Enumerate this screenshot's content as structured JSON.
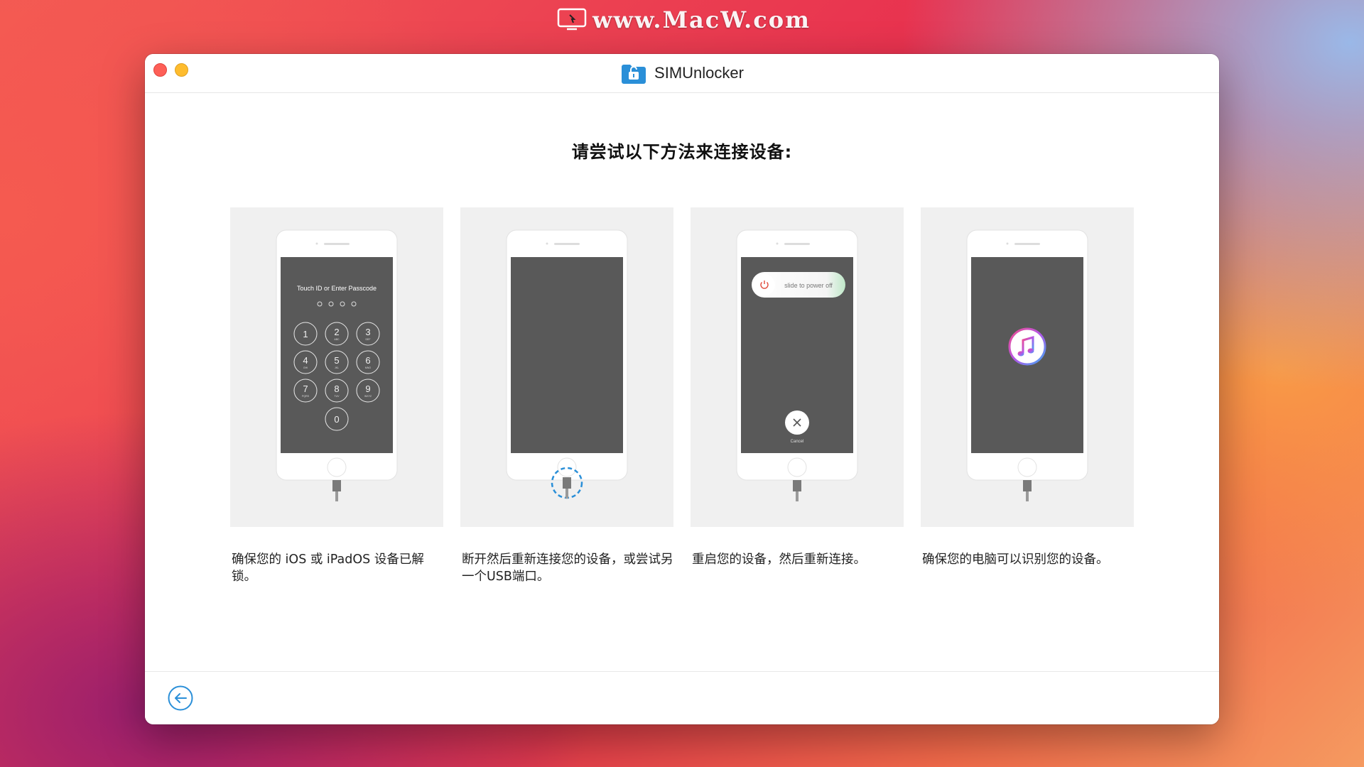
{
  "watermark": {
    "text": "www.MacW.com"
  },
  "window": {
    "title": "SIMUnlocker",
    "heading": "请尝试以下方法来连接设备:"
  },
  "cards": [
    {
      "caption": "确保您的 iOS 或 iPadOS 设备已解锁。",
      "screen": {
        "passcode_prompt": "Touch ID or Enter Passcode",
        "keys": [
          {
            "digit": "1",
            "letters": ""
          },
          {
            "digit": "2",
            "letters": "ABC"
          },
          {
            "digit": "3",
            "letters": "DEF"
          },
          {
            "digit": "4",
            "letters": "GHI"
          },
          {
            "digit": "5",
            "letters": "JKL"
          },
          {
            "digit": "6",
            "letters": "MNO"
          },
          {
            "digit": "7",
            "letters": "PQRS"
          },
          {
            "digit": "8",
            "letters": "TUV"
          },
          {
            "digit": "9",
            "letters": "WXYZ"
          },
          {
            "digit": "0",
            "letters": ""
          }
        ]
      }
    },
    {
      "caption": "断开然后重新连接您的设备，或尝试另一个USB端口。"
    },
    {
      "caption": "重启您的设备，然后重新连接。",
      "screen": {
        "slider_text": "slide to power off",
        "cancel_label": "Cancel"
      }
    },
    {
      "caption": "确保您的电脑可以识别您的设备。"
    }
  ],
  "colors": {
    "accent": "#2a8fd8",
    "phone_screen": "#595959",
    "card_bg": "#f0f0f0"
  },
  "icons": {
    "back": "arrow-left-circle-icon",
    "app": "unlock-folder-icon",
    "itunes": "music-note-icon"
  }
}
